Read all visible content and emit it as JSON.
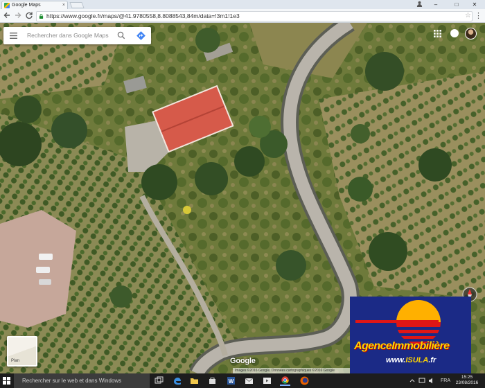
{
  "browser": {
    "tab_title": "Google Maps",
    "tab_close": "×",
    "url": "https://www.google.fr/maps/@41.9780558,8.8088543,84m/data=!3m1!1e3",
    "window_minimize": "–",
    "window_restore": "□",
    "window_close": "✕",
    "profile_icon": "user-icon"
  },
  "maps": {
    "search_placeholder": "Rechercher dans Google Maps",
    "google_logo": "Google",
    "attribution": "Images ©2016 Google, Données cartographiques ©2016 Google",
    "layer_thumb_label": "Plan"
  },
  "agency": {
    "title": "AgenceImmobilière",
    "site_prefix": "www.",
    "site_brand": "ISULA",
    "site_suffix": ".fr"
  },
  "taskbar": {
    "search_placeholder": "Rechercher sur le web et dans Windows",
    "language": "FRA",
    "time": "15:25",
    "date": "23/08/2016",
    "icons": [
      "task-view-icon",
      "edge-icon",
      "file-explorer-icon",
      "store-icon",
      "word-icon",
      "mail-icon",
      "media-icon",
      "chrome-icon",
      "firefox-icon"
    ]
  },
  "colors": {
    "agency_bg": "#1b2a86",
    "agency_yellow": "#ffd400",
    "agency_red": "#e01616",
    "roof": "#d65a4a",
    "road": "#b9b4ab"
  }
}
